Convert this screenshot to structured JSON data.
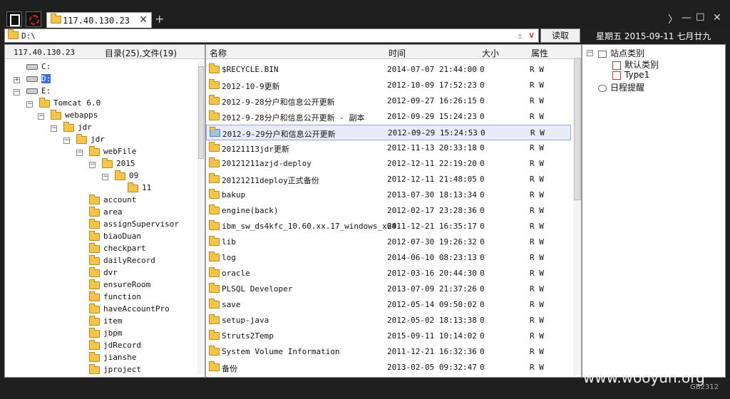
{
  "tab": {
    "title": "117.40.130.23",
    "close": "✕",
    "new": "+"
  },
  "window_controls": {
    "next": "〉",
    "minimize": "—",
    "maximize": "☐",
    "close": "✕"
  },
  "address": {
    "path": "D:\\",
    "pm": "± ",
    "dropdown": "∨",
    "read_button": "读取"
  },
  "date_label": "星期五 2015-09-11 七月廿九",
  "left": {
    "host": "117.40.130.23",
    "count": "目录(25),文件(19)",
    "tree": [
      {
        "label": "C:",
        "type": "drive"
      },
      {
        "label": "D:",
        "type": "drive"
      },
      {
        "label": "E:",
        "type": "drive"
      },
      {
        "label": "Tomcat 6.0",
        "type": "folder"
      },
      {
        "label": "webapps",
        "type": "folder"
      },
      {
        "label": "jdr",
        "type": "folder"
      },
      {
        "label": "jdr",
        "type": "folder"
      },
      {
        "label": "webFile",
        "type": "folder"
      },
      {
        "label": "2015",
        "type": "folder"
      },
      {
        "label": "09",
        "type": "folder"
      },
      {
        "label": "11",
        "type": "folder"
      },
      {
        "label": "account",
        "type": "folder"
      },
      {
        "label": "area",
        "type": "folder"
      },
      {
        "label": "assignSupervisor",
        "type": "folder"
      },
      {
        "label": "biaoDuan",
        "type": "folder"
      },
      {
        "label": "checkpart",
        "type": "folder"
      },
      {
        "label": "dailyRecord",
        "type": "folder"
      },
      {
        "label": "dvr",
        "type": "folder"
      },
      {
        "label": "ensureRoom",
        "type": "folder"
      },
      {
        "label": "function",
        "type": "folder"
      },
      {
        "label": "haveAccountPro",
        "type": "folder"
      },
      {
        "label": "item",
        "type": "folder"
      },
      {
        "label": "jbpm",
        "type": "folder"
      },
      {
        "label": "jdRecord",
        "type": "folder"
      },
      {
        "label": "jianshe",
        "type": "folder"
      },
      {
        "label": "jproject",
        "type": "folder"
      }
    ]
  },
  "files": {
    "headers": {
      "name": "名称",
      "time": "时间",
      "size": "大小",
      "attr": "属性"
    },
    "rows": [
      {
        "name": "$RECYCLE.BIN",
        "time": "2014-07-07 21:44:00",
        "size": "0",
        "attr": "R W"
      },
      {
        "name": "2012-10-9更新",
        "time": "2012-10-09 17:52:23",
        "size": "0",
        "attr": "R W"
      },
      {
        "name": "2012-9-28分户和信息公开更新",
        "time": "2012-09-27 16:26:15",
        "size": "0",
        "attr": "R W"
      },
      {
        "name": "2012-9-28分户和信息公开更新 - 副本",
        "time": "2012-09-29 15:24:23",
        "size": "0",
        "attr": "R W"
      },
      {
        "name": "2012-9-29分户和信息公开更新",
        "time": "2012-09-29 15:24:53",
        "size": "0",
        "attr": "R W"
      },
      {
        "name": "20121113jdr更新",
        "time": "2012-11-13 20:33:18",
        "size": "0",
        "attr": "R W"
      },
      {
        "name": "20121211azjd-deploy",
        "time": "2012-12-11 22:19:20",
        "size": "0",
        "attr": "R W"
      },
      {
        "name": "20121211deploy正式备份",
        "time": "2012-12-11 21:48:05",
        "size": "0",
        "attr": "R W"
      },
      {
        "name": "bakup",
        "time": "2013-07-30 18:13:34",
        "size": "0",
        "attr": "R W"
      },
      {
        "name": "engine(back)",
        "time": "2012-02-17 23:28:36",
        "size": "0",
        "attr": "R W"
      },
      {
        "name": "ibm_sw_ds4kfc_10.60.xx.17_windows_x64",
        "time": "2011-12-21 16:35:17",
        "size": "0",
        "attr": "R W"
      },
      {
        "name": "lib",
        "time": "2012-07-30 19:26:32",
        "size": "0",
        "attr": "R W"
      },
      {
        "name": "log",
        "time": "2014-06-10 08:23:13",
        "size": "0",
        "attr": "R W"
      },
      {
        "name": "oracle",
        "time": "2012-03-16 20:44:30",
        "size": "0",
        "attr": "R W"
      },
      {
        "name": "PLSQL Developer",
        "time": "2013-07-09 21:37:26",
        "size": "0",
        "attr": "R W"
      },
      {
        "name": "save",
        "time": "2012-05-14 09:50:02",
        "size": "0",
        "attr": "R W"
      },
      {
        "name": "setup-java",
        "time": "2012-05-02 18:13:38",
        "size": "0",
        "attr": "R W"
      },
      {
        "name": "Struts2Temp",
        "time": "2015-09-11 10:14:02",
        "size": "0",
        "attr": "R W"
      },
      {
        "name": "System Volume Information",
        "time": "2011-12-21 16:32:36",
        "size": "0",
        "attr": "R W"
      },
      {
        "name": "备份",
        "time": "2013-02-05 09:32:47",
        "size": "0",
        "attr": "R W"
      }
    ]
  },
  "right": {
    "site_category": "站点类别",
    "default_category": "默认类别",
    "type1": "Type1",
    "schedule": "日程提醒"
  },
  "watermark": "www.wooyun.org",
  "encoding": "GB2312"
}
